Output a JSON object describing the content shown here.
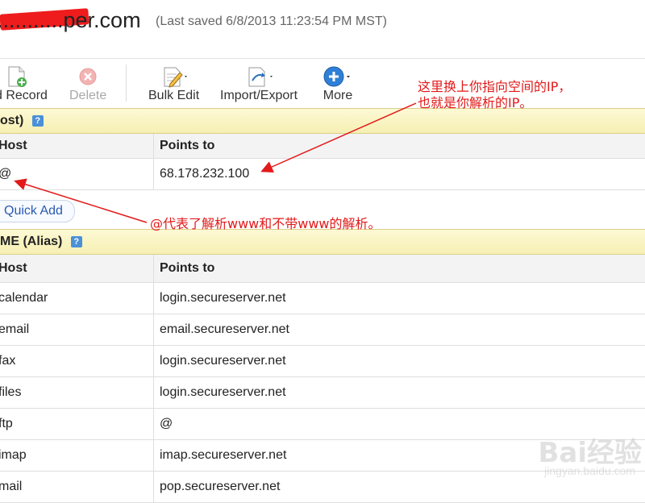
{
  "header": {
    "domain": "...........per.com",
    "last_saved": "(Last saved 6/8/2013 11:23:54 PM MST)"
  },
  "toolbar": {
    "add_record": "d Record",
    "delete": "Delete",
    "bulk_edit": "Bulk Edit",
    "import_export": "Import/Export",
    "more": "More"
  },
  "a_section": {
    "title": "ost)",
    "help": "?",
    "col_host": "Host",
    "col_points": "Points to",
    "rows": [
      {
        "host": "@",
        "points": "68.178.232.100"
      }
    ],
    "quick_add": "Quick Add"
  },
  "cname_section": {
    "title": "ME (Alias)",
    "help": "?",
    "col_host": "Host",
    "col_points": "Points to",
    "rows": [
      {
        "host": "calendar",
        "points": "login.secureserver.net"
      },
      {
        "host": "email",
        "points": "email.secureserver.net"
      },
      {
        "host": "fax",
        "points": "login.secureserver.net"
      },
      {
        "host": "files",
        "points": "login.secureserver.net"
      },
      {
        "host": "ftp",
        "points": "@"
      },
      {
        "host": "imap",
        "points": "imap.secureserver.net"
      },
      {
        "host": "mail",
        "points": "pop.secureserver.net"
      }
    ]
  },
  "annotations": {
    "ip_note_line1": "这里换上你指向空间的IP，",
    "ip_note_line2": "也就是你解析的IP。",
    "at_note": "@代表了解析www和不带www的解析。",
    "color": "#e21a1a"
  },
  "watermark": {
    "text": "Bai经验",
    "sub": "jingyan.baidu.com"
  }
}
